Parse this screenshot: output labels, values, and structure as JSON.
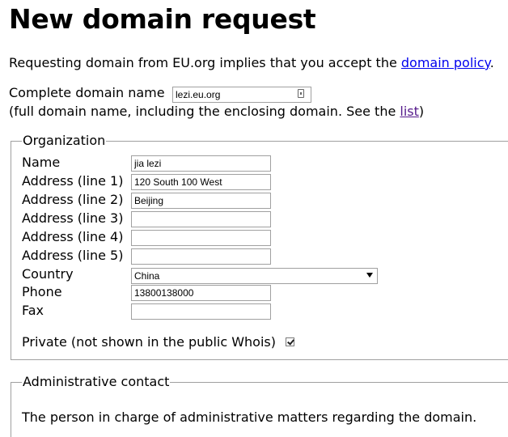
{
  "page": {
    "title": "New domain request",
    "intro_text": "Requesting domain from EU.org implies that you accept the ",
    "intro_link": "domain policy",
    "intro_end": "."
  },
  "domain": {
    "label": "Complete domain name",
    "value": "lezi.eu.org",
    "hint_text": "(full domain name, including the enclosing domain. See the ",
    "hint_link": "list",
    "hint_end": ")"
  },
  "organization": {
    "legend": "Organization",
    "fields": [
      {
        "label": "Name",
        "value": ""
      },
      {
        "label": "Address (line 1)",
        "value": "120 South 100 West"
      },
      {
        "label": "Address (line 2)",
        "value": "Beijing"
      },
      {
        "label": "Address (line 3)",
        "value": ""
      },
      {
        "label": "Address (line 4)",
        "value": ""
      },
      {
        "label": "Address (line 5)",
        "value": ""
      }
    ],
    "name_value": "jia lezi",
    "country_label": "Country",
    "country_value": "China",
    "phone_label": "Phone",
    "phone_value": "13800138000",
    "fax_label": "Fax",
    "fax_value": "",
    "private_label": "Private (not shown in the public Whois)",
    "private_checked": true
  },
  "admin": {
    "legend": "Administrative contact",
    "description": "The person in charge of administrative matters regarding the domain."
  }
}
